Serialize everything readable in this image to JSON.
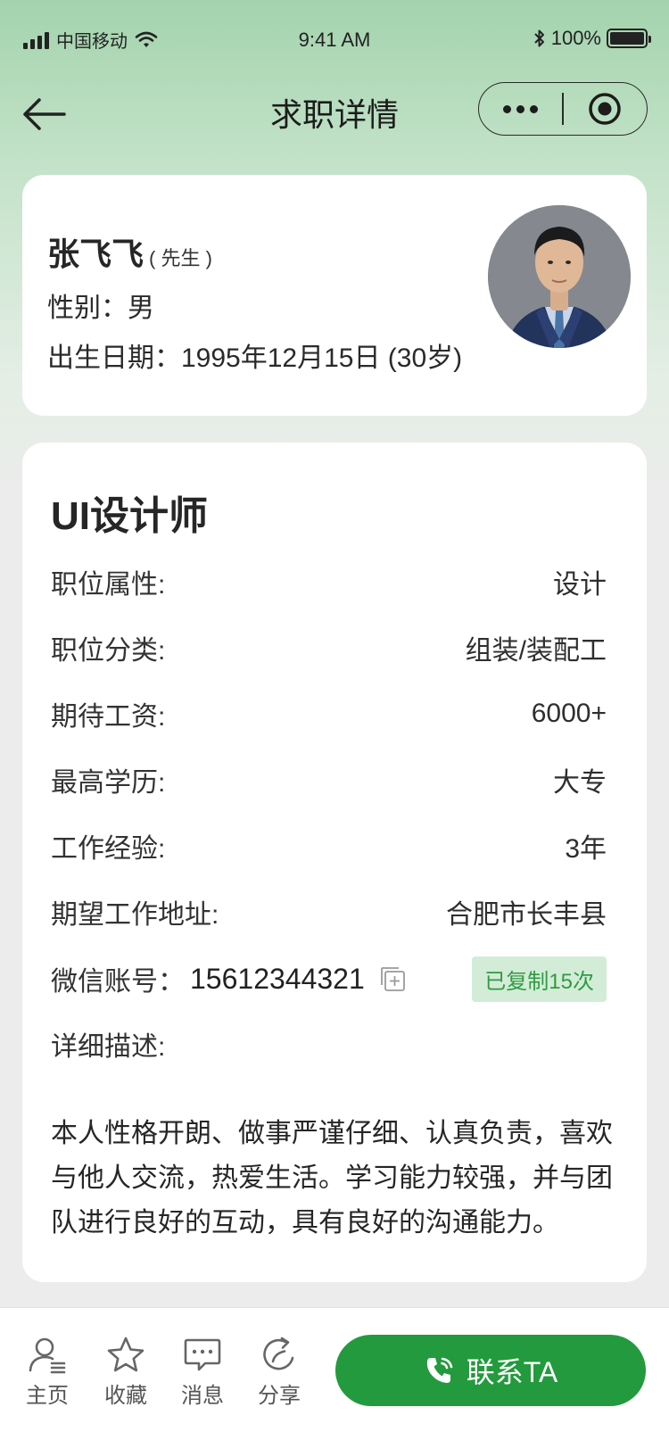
{
  "status_bar": {
    "carrier": "中国移动",
    "time": "9:41 AM",
    "battery_text": "100%",
    "battery_level": 1.0
  },
  "nav": {
    "title": "求职详情"
  },
  "profile": {
    "name": "张飞飞",
    "honorific": "( 先生 )",
    "gender_line": "性别：男",
    "birth_line": "出生日期：1995年12月15日 (30岁)"
  },
  "job": {
    "title": "UI设计师",
    "rows": [
      {
        "label": "职位属性:",
        "value": "设计"
      },
      {
        "label": "职位分类:",
        "value": "组装/装配工"
      },
      {
        "label": "期待工资:",
        "value": "6000+"
      },
      {
        "label": "最高学历:",
        "value": "大专"
      },
      {
        "label": "工作经验:",
        "value": "3年"
      },
      {
        "label": "期望工作地址:",
        "value": "合肥市长丰县"
      }
    ],
    "wechat_label": "微信账号：",
    "wechat_number": "15612344321",
    "copy_badge": "已复制15次",
    "desc_label": "详细描述:",
    "description": "本人性格开朗、做事严谨仔细、认真负责，喜欢与他人交流，热爱生活。学习能力较强，并与团队进行良好的互动，具有良好的沟通能力。"
  },
  "bottom_bar": {
    "tabs": [
      {
        "label": "主页",
        "icon": "user-icon"
      },
      {
        "label": "收藏",
        "icon": "star-icon"
      },
      {
        "label": "消息",
        "icon": "message-icon"
      },
      {
        "label": "分享",
        "icon": "share-icon"
      }
    ],
    "contact_label": "联系TA"
  },
  "colors": {
    "accent": "#239a3d",
    "badge_bg": "#d3ecd7",
    "badge_text": "#2f9b43"
  }
}
